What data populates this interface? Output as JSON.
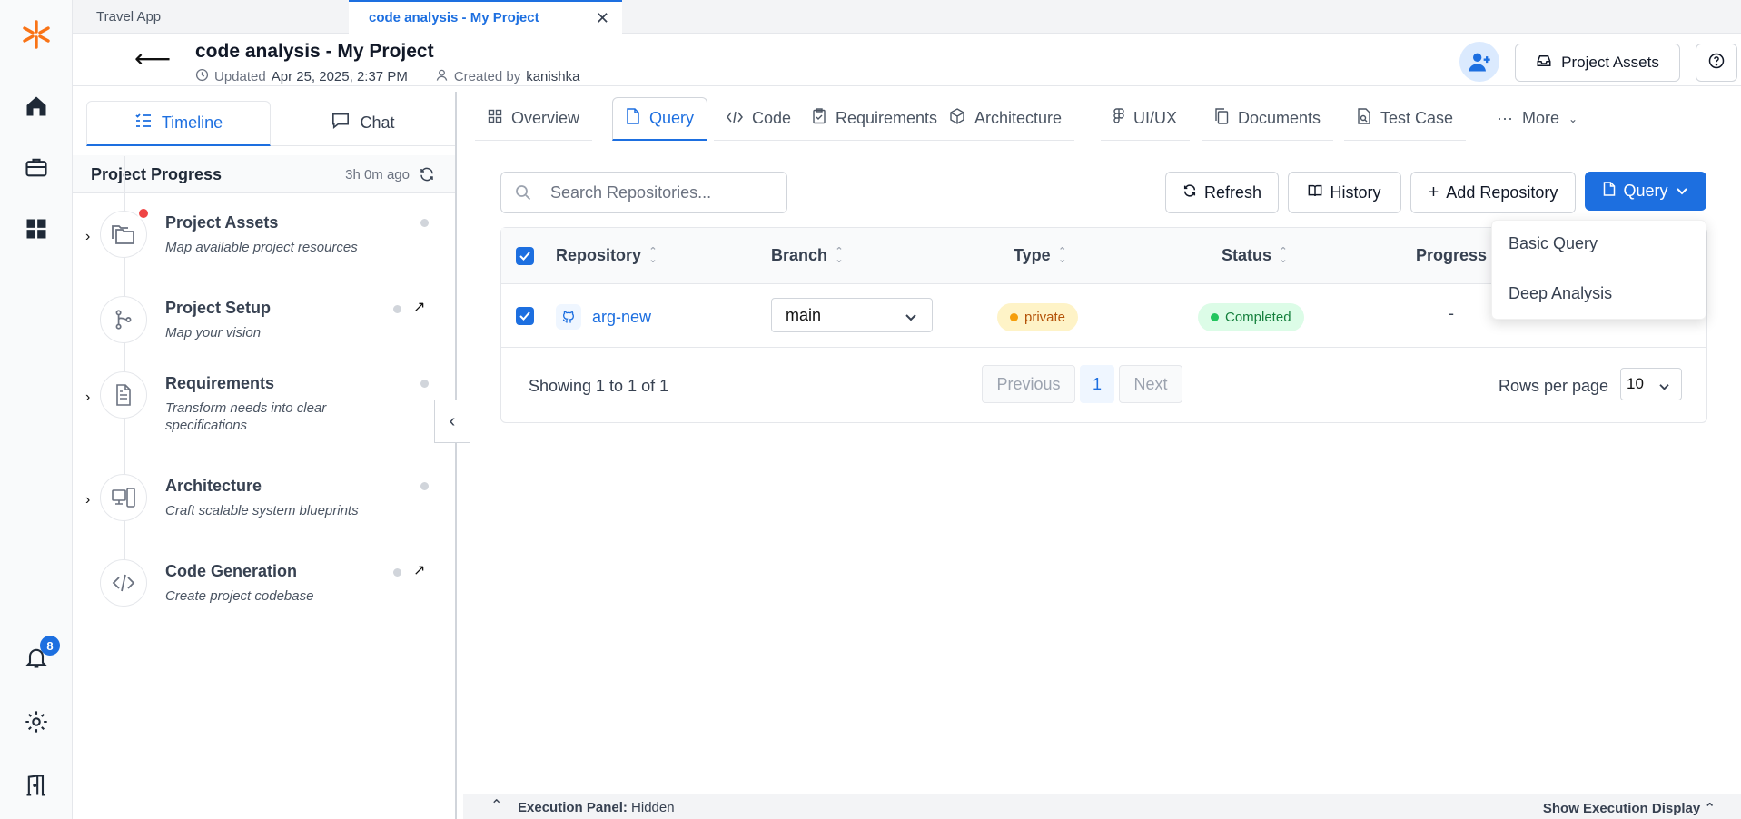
{
  "browser_tabs": [
    {
      "label": "Travel App",
      "active": false
    },
    {
      "label": "code analysis - My Project",
      "active": true
    }
  ],
  "header": {
    "title": "code analysis - My Project",
    "updated_label": "Updated",
    "updated_value": "Apr 25, 2025, 2:37 PM",
    "created_label": "Created by",
    "created_value": "kanishka",
    "project_assets_label": "Project Assets"
  },
  "rail": {
    "notification_count": "8",
    "icons": [
      "logo-icon",
      "home-icon",
      "briefcase-icon",
      "grid-icon",
      "bell-icon",
      "gear-icon",
      "exit-icon"
    ]
  },
  "left_panel": {
    "tabs": [
      {
        "label": "Timeline",
        "active": true
      },
      {
        "label": "Chat",
        "active": false
      }
    ],
    "progress_title": "Project Progress",
    "progress_ago": "3h 0m ago",
    "steps": [
      {
        "name": "Project Assets",
        "desc": "Map available project resources"
      },
      {
        "name": "Project Setup",
        "desc": "Map your vision"
      },
      {
        "name": "Requirements",
        "desc": "Transform needs into clear specifications"
      },
      {
        "name": "Architecture",
        "desc": "Craft scalable system blueprints"
      },
      {
        "name": "Code Generation",
        "desc": "Create project codebase"
      }
    ]
  },
  "main_tabs": [
    {
      "label": "Overview"
    },
    {
      "label": "Query"
    },
    {
      "label": "Code"
    },
    {
      "label": "Requirements"
    },
    {
      "label": "Architecture"
    },
    {
      "label": "UI/UX"
    },
    {
      "label": "Documents"
    },
    {
      "label": "Test Case"
    },
    {
      "label": "More"
    }
  ],
  "toolbar": {
    "search_placeholder": "Search Repositories...",
    "refresh": "Refresh",
    "history": "History",
    "add_repository": "Add Repository",
    "query": "Query"
  },
  "query_menu": [
    "Basic Query",
    "Deep Analysis"
  ],
  "table": {
    "columns": [
      "Repository",
      "Branch",
      "Type",
      "Status",
      "Progress"
    ],
    "rows": [
      {
        "repository": "arg-new",
        "branch": "main",
        "type": "private",
        "status": "Completed",
        "progress": "-"
      }
    ],
    "showing": "Showing 1 to 1 of 1",
    "prev": "Previous",
    "page": "1",
    "next": "Next",
    "rows_per_page_label": "Rows per page",
    "rows_per_page": "10"
  },
  "bottom_bar": {
    "label": "Execution Panel:",
    "value": "Hidden",
    "right": "Show Execution Display"
  },
  "colors": {
    "accent": "#1d6fe0",
    "logo": "#f97316",
    "completed": "#22c55e",
    "private": "#f59e0b"
  }
}
